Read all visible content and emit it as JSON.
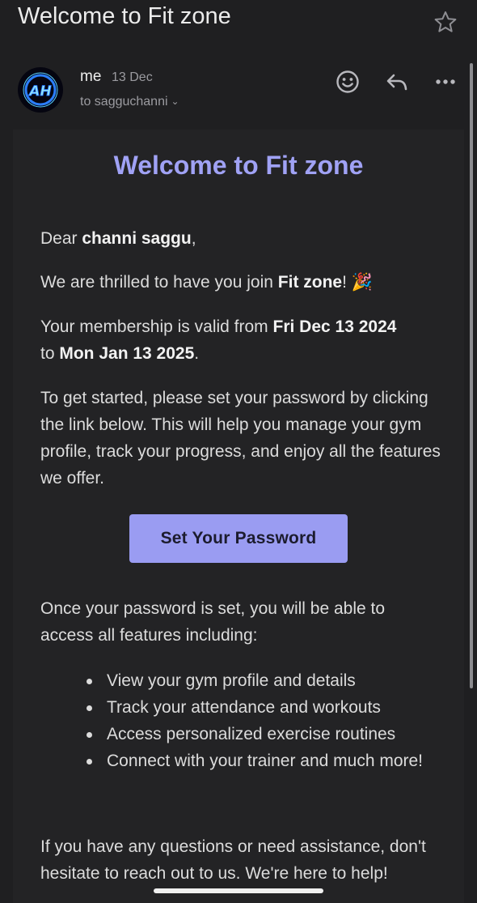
{
  "subject": "Welcome to Fit zone",
  "avatar": {
    "initials": "AH"
  },
  "sender": {
    "name": "me",
    "date": "13 Dec",
    "recipient_text": "to sagguchanni"
  },
  "header_icons": [
    "emoji-icon",
    "reply-icon",
    "more-icon"
  ],
  "email": {
    "title": "Welcome to Fit zone",
    "greeting_prefix": "Dear ",
    "recipient_name": "channi saggu",
    "greeting_suffix": ",",
    "thrilled_prefix": "We are thrilled to have you join ",
    "gym_name": "Fit zone",
    "thrilled_suffix": "!",
    "celebration_emoji": "🎉",
    "validity_prefix": "Your membership is valid from ",
    "start_date": "Fri Dec 13 2024",
    "validity_mid": "to ",
    "end_date": "Mon Jan 13 2025",
    "validity_suffix": ".",
    "instructions": "To get started, please set your password by clicking the link below. This will help you manage your gym profile, track your progress, and enjoy all the features we offer.",
    "cta_label": "Set Your Password",
    "after_password": "Once your password is set, you will be able to access all features including:",
    "features": [
      "View your gym profile and details",
      "Track your attendance and workouts",
      "Access personalized exercise routines",
      "Connect with your trainer and much more!"
    ],
    "closing": "If you have any questions or need assistance, don't hesitate to reach out to us. We're here to help!"
  },
  "colors": {
    "background": "#1f1f21",
    "accent": "#a0a2f5",
    "button": "#9a9cf2",
    "button_text": "#1c1c2e"
  }
}
